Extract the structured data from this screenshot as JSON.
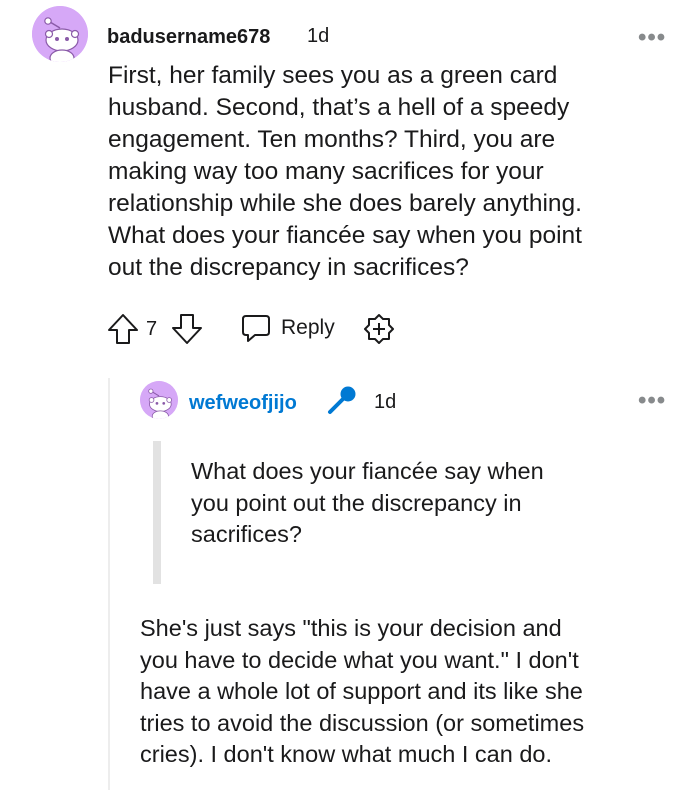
{
  "comment": {
    "username": "badusername678",
    "time": "1d",
    "more": "•••",
    "body_lines": [
      "First, her family sees you as a green card",
      "husband. Second, that’s a hell of a speedy",
      "engagement. Ten months? Third, you are",
      "making way too many sacrifices for your",
      "relationship while she does barely anything.",
      "What does your fiancée say when you point",
      "out the discrepancy in sacrifices?"
    ],
    "vote_count": "7",
    "reply_label": "Reply",
    "icons": [
      "upvote-icon",
      "downvote-icon",
      "reply-bubble-icon",
      "award-icon"
    ]
  },
  "reply": {
    "username": "wefweofjijo",
    "time": "1d",
    "more": "•••",
    "user_color": "#0079d3",
    "quote_lines": [
      "What does your fiancée say when",
      "you point out the discrepancy in",
      "sacrifices?"
    ],
    "body_lines": [
      "She's just says \"this is your decision and",
      "you have to decide what you want.\" I don't",
      "have a whole lot of support and its like she",
      "tries to avoid the discussion (or sometimes",
      "cries). I don't know what much I can do."
    ],
    "icons": [
      "microphone-icon"
    ]
  }
}
